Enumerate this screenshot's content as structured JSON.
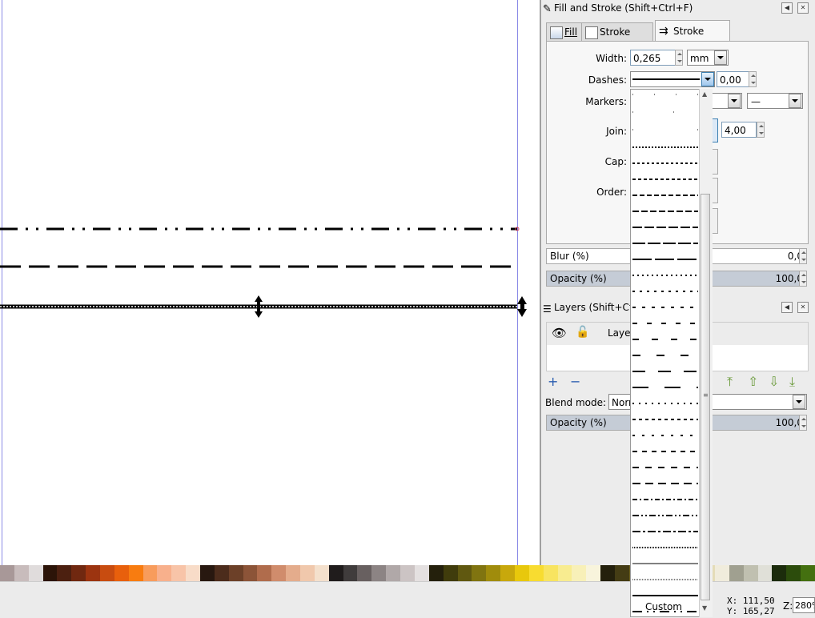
{
  "fill_stroke_panel": {
    "title": "Fill and Stroke (Shift+Ctrl+F)",
    "tabs": [
      {
        "label": "Fill",
        "active": false
      },
      {
        "label": "Stroke paint",
        "active": false
      },
      {
        "label": "Stroke style",
        "active": true
      }
    ],
    "width_label": "Width:",
    "width_value": "0,265",
    "width_unit": "mm",
    "dashes_label": "Dashes:",
    "dash_offset": "0,00",
    "markers_label": "Markers:",
    "join_label": "Join:",
    "miter_limit": "4,00",
    "cap_label": "Cap:",
    "order_label": "Order:",
    "blur_label": "Blur (%)",
    "blur_value": "0,0",
    "opacity_label": "Opacity (%)",
    "opacity_value": "100,0"
  },
  "layers_panel": {
    "title": "Layers (Shift+Ctrl+",
    "layer_name": "Layer",
    "blend_mode_label": "Blend mode:",
    "blend_mode_value": "Norr",
    "opacity_label": "Opacity (%)",
    "opacity_value": "100,0"
  },
  "dash_dropdown": {
    "custom_label": "Custom"
  },
  "status": {
    "x_label": "X:",
    "x_value": "111,50",
    "y_label": "Y:",
    "y_value": "165,27",
    "zoom_label": "Z:",
    "zoom_value": "280%"
  },
  "colors": {
    "guide": "#8a8ae6",
    "selected_tab_bg": "#f7f7f7",
    "opacity_fill": "#c5ccd6"
  },
  "palette": [
    "#a89898",
    "#c8bcbc",
    "#e0dcdc",
    "#2c1408",
    "#4c2010",
    "#702810",
    "#9c3410",
    "#c84c10",
    "#e8600c",
    "#f87c10",
    "#f89c5c",
    "#f8b08c",
    "#f8c4a8",
    "#f8dcc8",
    "#281810",
    "#4c2c1c",
    "#6c4028",
    "#8c5438",
    "#b06c4c",
    "#d08c6c",
    "#e4ac8c",
    "#f0c8ac",
    "#f4e0cc",
    "#201c1c",
    "#403c3c",
    "#686060",
    "#8c8484",
    "#b0a8a8",
    "#ccc4c4",
    "#e4e0e0",
    "#24200c",
    "#403c0c",
    "#605810",
    "#807410",
    "#a08c0c",
    "#c8a80c",
    "#e8c80c",
    "#f8dc30",
    "#f8e460",
    "#f8ec90",
    "#f8f0b8",
    "#f8f4dc",
    "#24200c",
    "#443c14",
    "#6c6020",
    "#908030",
    "#b0a048",
    "#ccbc68",
    "#d8cc90",
    "#e4dcb8",
    "#f0ecdc",
    "#a0a090",
    "#c0c0b0",
    "#e0e0d8",
    "#1c2c0c",
    "#2c4c0c",
    "#447010"
  ]
}
